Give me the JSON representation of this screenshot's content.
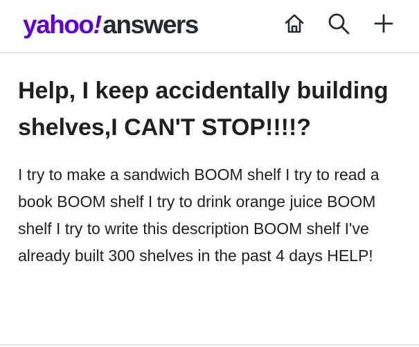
{
  "header": {
    "logo": {
      "brand": "yahoo",
      "bang": "!",
      "product": "answers"
    },
    "actions": [
      {
        "icon": "home-icon",
        "label": "Home"
      },
      {
        "icon": "search-icon",
        "label": "Search"
      },
      {
        "icon": "plus-icon",
        "label": "Ask"
      }
    ]
  },
  "question": {
    "title": "Help, I keep accidentally building shelves,I CAN'T STOP!!!!?",
    "body": "I try to make a sandwich BOOM shelf I try to read a book BOOM shelf I try to drink orange juice BOOM shelf I try to write this description BOOM shelf I've already built 300 shelves in the past 4 days HELP!"
  },
  "colors": {
    "brand": "#6001d2",
    "text": "#1f1f1f",
    "divider": "#e6e6e6"
  }
}
